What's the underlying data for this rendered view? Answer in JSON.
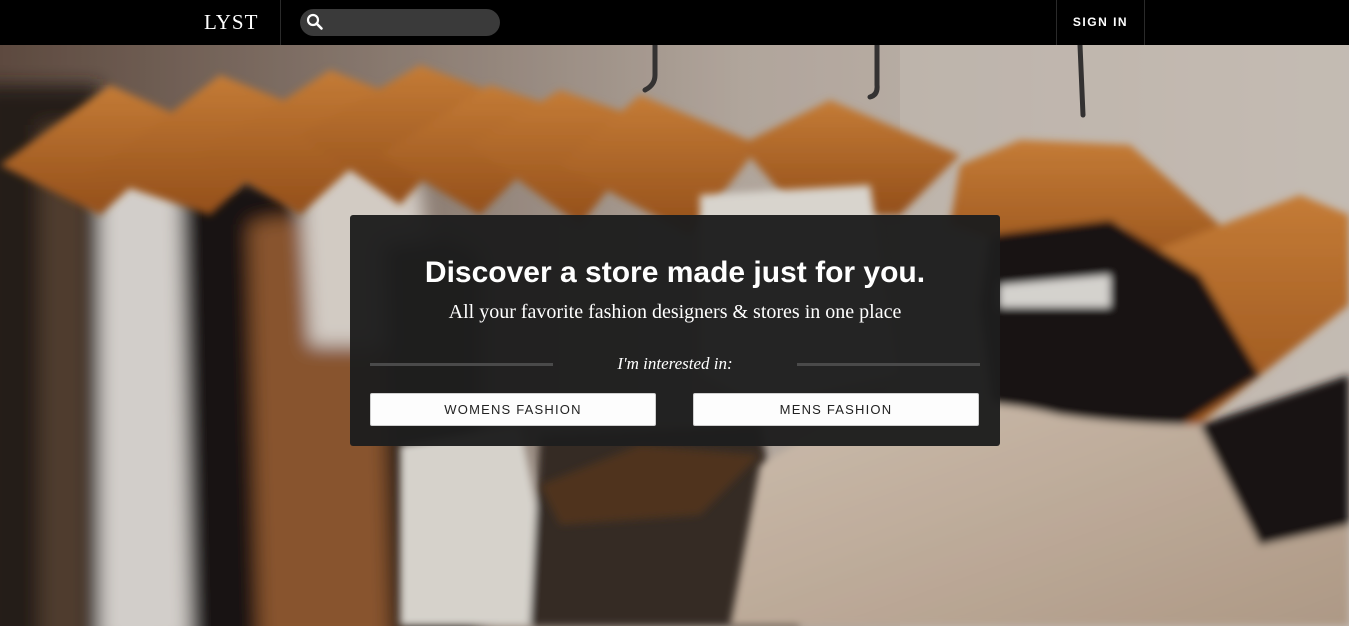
{
  "header": {
    "logo_text": "LYST",
    "search": {
      "placeholder": "",
      "value": "",
      "icon": "search-icon"
    },
    "signin_label": "SIGN IN"
  },
  "hero": {
    "background": "blurred-clothing-rack-photo"
  },
  "card": {
    "title": "Discover a store made just for you.",
    "subtitle": "All your favorite fashion designers & stores in one place",
    "interest_label": "I'm interested in:",
    "buttons": [
      {
        "label": "WOMENS FASHION"
      },
      {
        "label": "MENS FASHION"
      }
    ]
  },
  "colors": {
    "topbar": "#000000",
    "card": "#1e1e1e",
    "button": "#fdfdfd",
    "accent_text": "#ffffff"
  }
}
